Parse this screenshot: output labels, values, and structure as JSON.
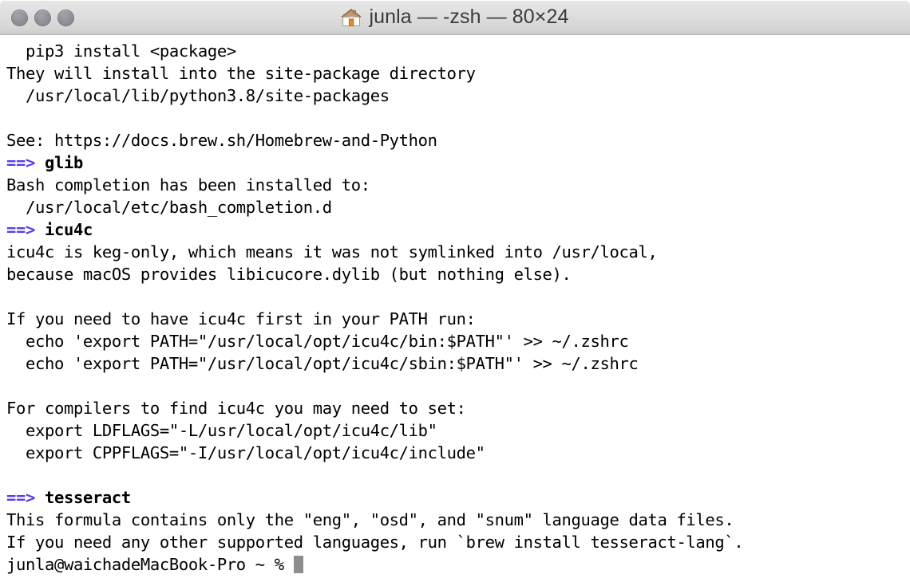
{
  "window": {
    "title": "junla — -zsh — 80×24",
    "title_icon": "home-folder-icon",
    "columns": 80,
    "rows": 24,
    "state": "inactive"
  },
  "titlebar": {
    "close_label": "",
    "minimize_label": "",
    "zoom_label": ""
  },
  "colors": {
    "marker_purple": "#5b3ee8",
    "text": "#000000",
    "background": "#ffffff",
    "cursor": "#8e8e8e",
    "titlebar_top": "#e8e8e8",
    "titlebar_bottom": "#c9c9c9",
    "traffic_light": "#91919a"
  },
  "terminal": {
    "lines": [
      {
        "kind": "plain",
        "text": "  pip3 install <package>"
      },
      {
        "kind": "plain",
        "text": "They will install into the site-package directory"
      },
      {
        "kind": "plain",
        "text": "  /usr/local/lib/python3.8/site-packages"
      },
      {
        "kind": "blank",
        "text": ""
      },
      {
        "kind": "plain",
        "text": "See: https://docs.brew.sh/Homebrew-and-Python"
      },
      {
        "kind": "marker",
        "marker": "==>",
        "formula": "glib"
      },
      {
        "kind": "plain",
        "text": "Bash completion has been installed to:"
      },
      {
        "kind": "plain",
        "text": "  /usr/local/etc/bash_completion.d"
      },
      {
        "kind": "marker",
        "marker": "==>",
        "formula": "icu4c"
      },
      {
        "kind": "plain",
        "text": "icu4c is keg-only, which means it was not symlinked into /usr/local,"
      },
      {
        "kind": "plain",
        "text": "because macOS provides libicucore.dylib (but nothing else)."
      },
      {
        "kind": "blank",
        "text": ""
      },
      {
        "kind": "plain",
        "text": "If you need to have icu4c first in your PATH run:"
      },
      {
        "kind": "plain",
        "text": "  echo 'export PATH=\"/usr/local/opt/icu4c/bin:$PATH\"' >> ~/.zshrc"
      },
      {
        "kind": "plain",
        "text": "  echo 'export PATH=\"/usr/local/opt/icu4c/sbin:$PATH\"' >> ~/.zshrc"
      },
      {
        "kind": "blank",
        "text": ""
      },
      {
        "kind": "plain",
        "text": "For compilers to find icu4c you may need to set:"
      },
      {
        "kind": "plain",
        "text": "  export LDFLAGS=\"-L/usr/local/opt/icu4c/lib\""
      },
      {
        "kind": "plain",
        "text": "  export CPPFLAGS=\"-I/usr/local/opt/icu4c/include\""
      },
      {
        "kind": "blank",
        "text": ""
      },
      {
        "kind": "marker",
        "marker": "==>",
        "formula": "tesseract"
      },
      {
        "kind": "plain",
        "text": "This formula contains only the \"eng\", \"osd\", and \"snum\" language data files."
      },
      {
        "kind": "plain",
        "text": "If you need any other supported languages, run `brew install tesseract-lang`."
      },
      {
        "kind": "prompt",
        "text": "junla@waichadeMacBook-Pro ~ % "
      }
    ]
  }
}
